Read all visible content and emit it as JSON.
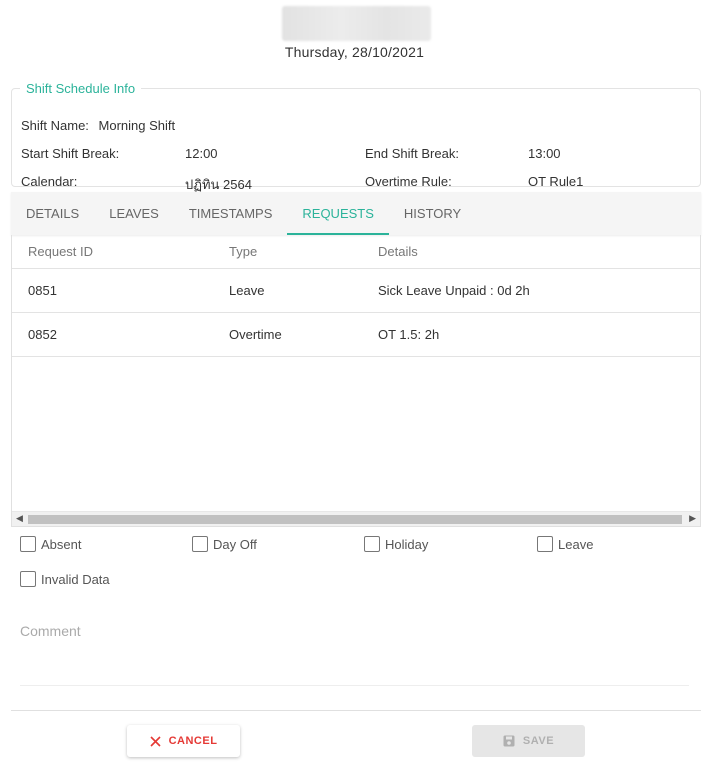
{
  "header": {
    "date": "Thursday, 28/10/2021"
  },
  "shift_info": {
    "legend": "Shift Schedule Info",
    "shift_name_label": "Shift Name:",
    "shift_name_value": "Morning Shift",
    "start_break_label": "Start Shift Break:",
    "start_break_value": "12:00",
    "end_break_label": "End Shift Break:",
    "end_break_value": "13:00",
    "calendar_label": "Calendar:",
    "calendar_value": "ปฏิทิน 2564",
    "overtime_rule_label": "Overtime Rule:",
    "overtime_rule_value": "OT Rule1"
  },
  "tabs": [
    {
      "label": "DETAILS"
    },
    {
      "label": "LEAVES"
    },
    {
      "label": "TIMESTAMPS"
    },
    {
      "label": "REQUESTS"
    },
    {
      "label": "HISTORY"
    }
  ],
  "active_tab": "REQUESTS",
  "requests_table": {
    "columns": [
      "Request ID",
      "Type",
      "Details"
    ],
    "rows": [
      {
        "id": "0851",
        "type": "Leave",
        "details": "Sick Leave Unpaid : 0d 2h"
      },
      {
        "id": "0852",
        "type": "Overtime",
        "details": "OT 1.5: 2h"
      }
    ]
  },
  "checkboxes": {
    "absent": "Absent",
    "day_off": "Day Off",
    "holiday": "Holiday",
    "leave": "Leave",
    "invalid_data": "Invalid Data"
  },
  "comment": {
    "placeholder": "Comment"
  },
  "actions": {
    "cancel_label": "CANCEL",
    "save_label": "SAVE"
  },
  "colors": {
    "accent": "#2bb39a",
    "cancel": "#e53935",
    "disabled": "#e6e6e6"
  }
}
